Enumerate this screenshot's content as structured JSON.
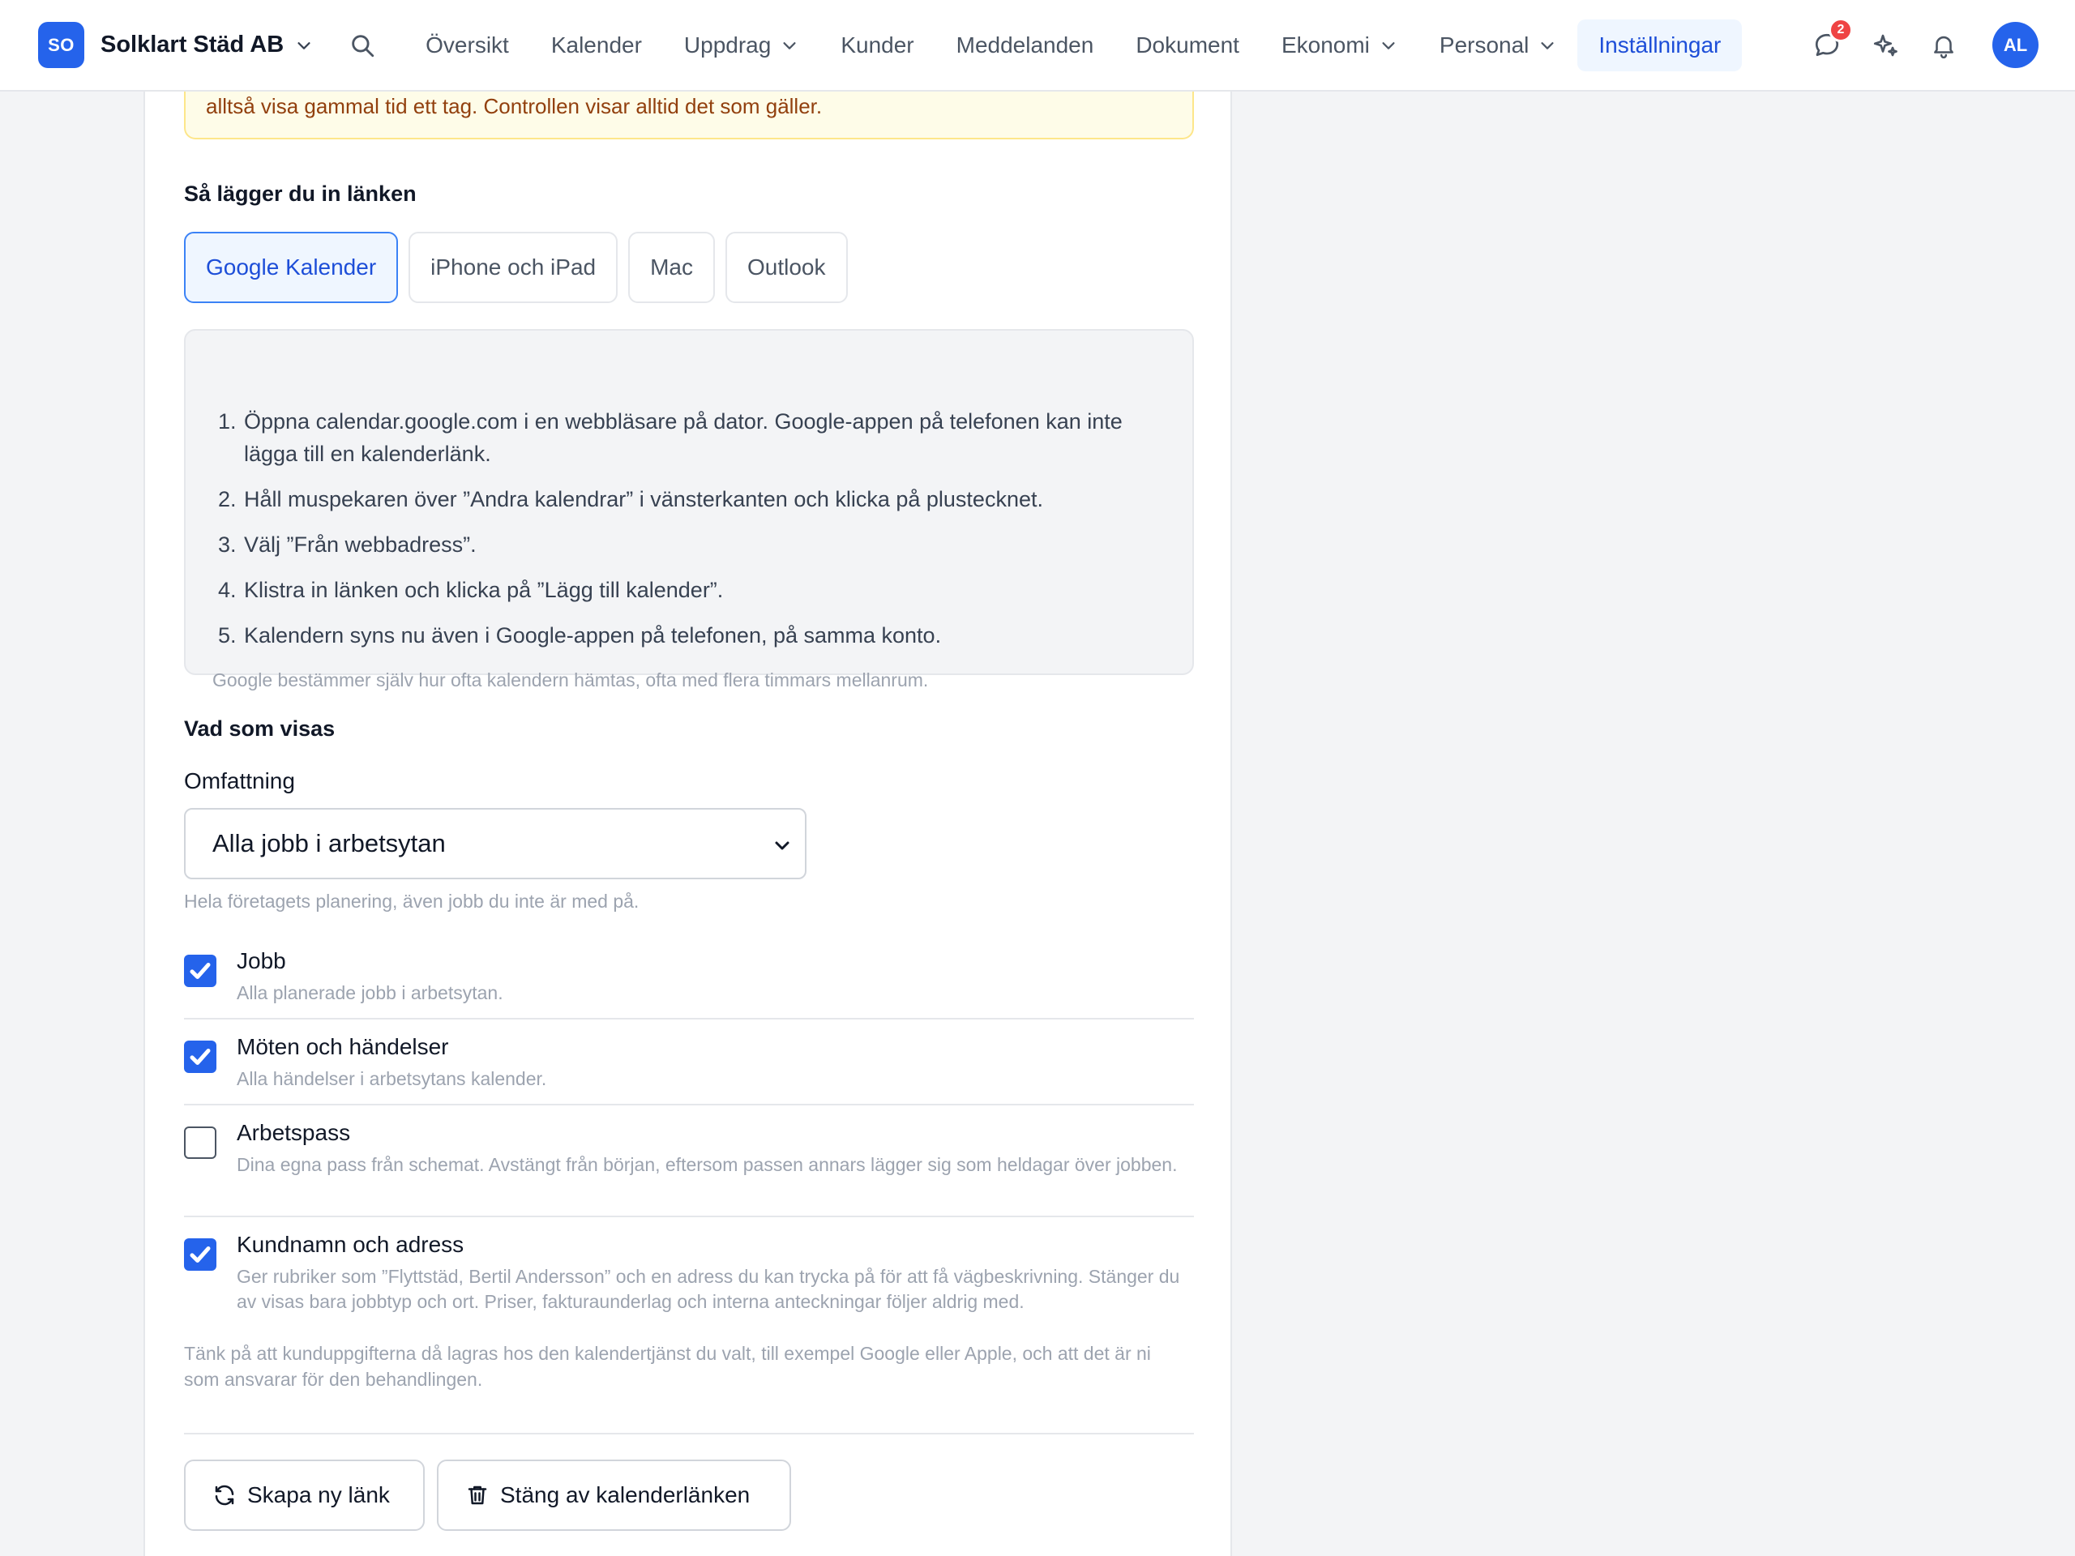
{
  "header": {
    "org_initials": "SO",
    "org_name": "Solklart Städ AB",
    "nav": [
      {
        "label": "Översikt"
      },
      {
        "label": "Kalender"
      },
      {
        "label": "Uppdrag"
      },
      {
        "label": "Kunder"
      },
      {
        "label": "Meddelanden"
      },
      {
        "label": "Dokument"
      },
      {
        "label": "Ekonomi"
      },
      {
        "label": "Personal"
      },
      {
        "label": "Inställningar"
      }
    ],
    "messages_badge": "2",
    "avatar_initials": "AL"
  },
  "warning": {
    "text": "alltså visa gammal tid ett tag. Controllen visar alltid det som gäller."
  },
  "setup": {
    "title": "Så lägger du in länken",
    "tabs": [
      "Google Kalender",
      "iPhone och iPad",
      "Mac",
      "Outlook"
    ],
    "active_tab": "Google Kalender",
    "steps": [
      "Öppna calendar.google.com i en webbläsare på dator. Google-appen på telefonen kan inte lägga till en kalenderlänk.",
      "Håll muspekaren över ”Andra kalendrar” i vänsterkanten och klicka på plustecknet.",
      "Välj ”Från webbadress”.",
      "Klistra in länken och klicka på ”Lägg till kalender”.",
      "Kalendern syns nu även i Google-appen på telefonen, på samma konto."
    ],
    "step_numbers": [
      "1.",
      "2.",
      "3.",
      "4.",
      "5."
    ],
    "note": "Google bestämmer själv hur ofta kalendern hämtas, ofta med flera timmars mellanrum."
  },
  "display": {
    "title": "Vad som visas",
    "scope_label": "Omfattning",
    "scope_value": "Alla jobb i arbetsytan",
    "scope_help": "Hela företagets planering, även jobb du inte är med på.",
    "options": [
      {
        "title": "Jobb",
        "desc": "Alla planerade jobb i arbetsytan.",
        "checked": true
      },
      {
        "title": "Möten och händelser",
        "desc": "Alla händelser i arbetsytans kalender.",
        "checked": true
      },
      {
        "title": "Arbetspass",
        "desc": "Dina egna pass från schemat. Avstängt från början, eftersom passen annars lägger sig som heldagar över jobben.",
        "checked": false
      },
      {
        "title": "Kundnamn och adress",
        "desc": "Ger rubriker som ”Flyttstäd, Bertil Andersson” och en adress du kan trycka på för att få vägbeskrivning. Stänger du av visas bara jobbtyp och ort. Priser, fakturaunderlag och interna anteckningar följer aldrig med.",
        "checked": true
      }
    ],
    "privacy_note": "Tänk på att kunduppgifterna då lagras hos den kalendertjänst du valt, till exempel Google eller Apple, och att det är ni som ansvarar för den behandlingen."
  },
  "actions": {
    "new_link": "Skapa ny länk",
    "disable_link": "Stäng av kalenderlänken"
  },
  "colors": {
    "accent": "#2563eb",
    "warning_bg": "#fefce8",
    "warning_text": "#92400e",
    "badge": "#ef4444"
  }
}
